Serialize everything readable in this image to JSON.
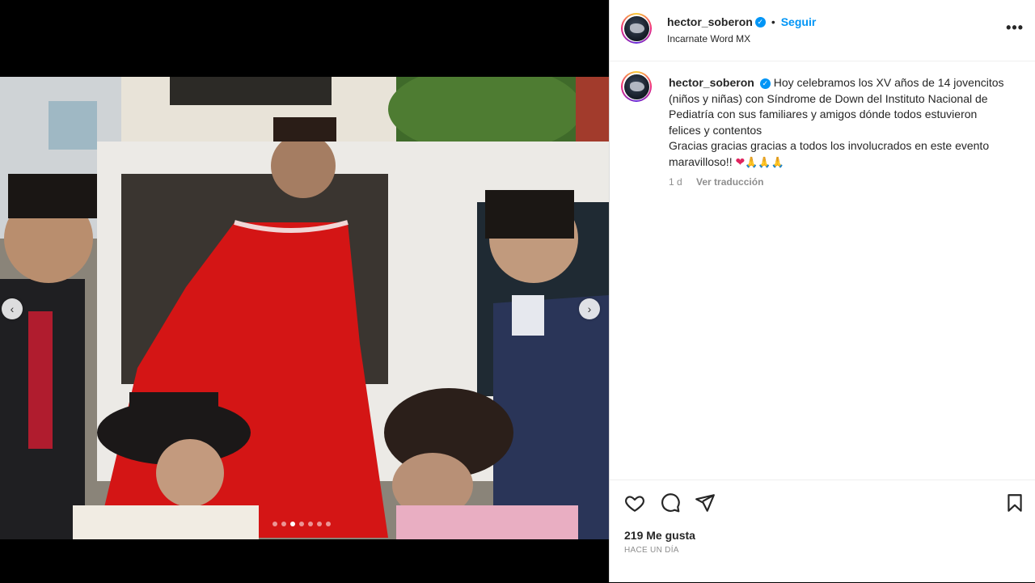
{
  "post": {
    "username": "hector_soberon",
    "follow_label": "Seguir",
    "bullet": "•",
    "location": "Incarnate Word MX",
    "more_label": "•••",
    "verified_mark": "✓"
  },
  "caption": {
    "username": "hector_soberon",
    "line1": "Hoy celebramos los XV años de 14 jovencitos",
    "line2": "(niños y niñas) con Síndrome de Down del Instituto Nacional de",
    "line3": "Pediatría con sus familiares y amigos dónde todos estuvieron",
    "line4": "felices y contentos",
    "line5": "Gracias gracias gracias a todos los involucrados en este evento",
    "line6": "maravilloso!!",
    "emoji_heart": "❤",
    "emoji_pray": "🙏🙏🙏"
  },
  "meta": {
    "time": "1 d",
    "translate_label": "Ver traducción"
  },
  "footer": {
    "likes": "219 Me gusta",
    "posted": "HACE UN DÍA"
  },
  "carousel": {
    "prev_label": "‹",
    "next_label": "›",
    "slide_count": 7,
    "active_slide": 3
  },
  "colors": {
    "accent": "#0095f6",
    "dress": "#d41515",
    "panel_bg": "#ffffff"
  }
}
